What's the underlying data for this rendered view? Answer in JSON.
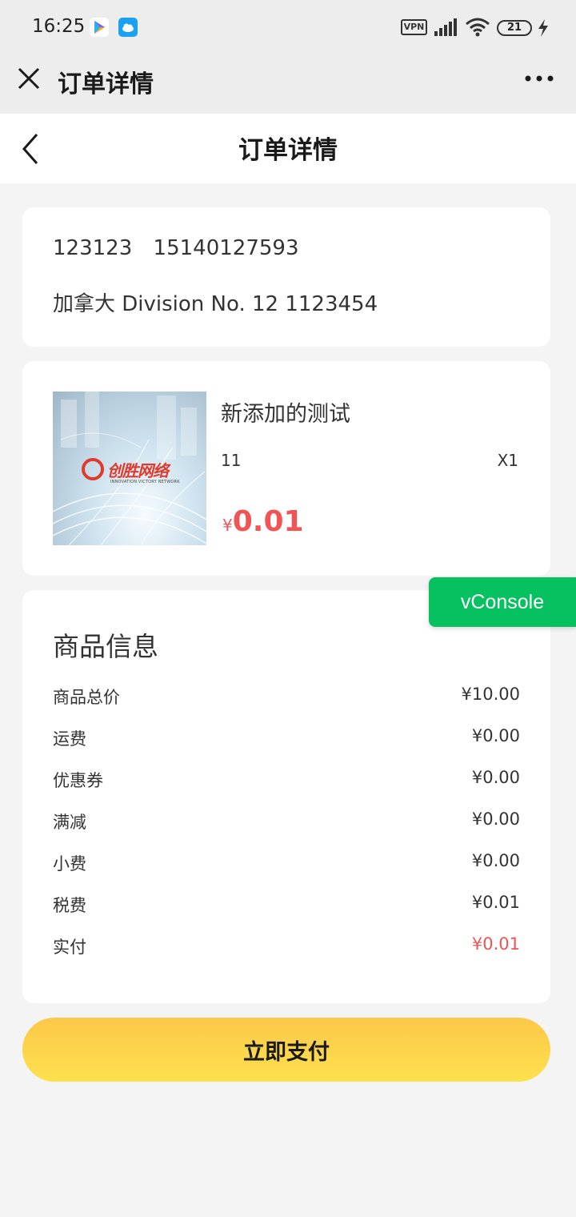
{
  "status_bar": {
    "time": "16:25",
    "vpn": "VPN",
    "battery": "21",
    "icons": [
      "play-store-icon",
      "cloud-app-icon",
      "signal-icon",
      "wifi-icon",
      "charging-icon"
    ]
  },
  "wechat_bar": {
    "title": "订单详情",
    "close_icon": "close-icon",
    "more_icon": "more-dots-icon"
  },
  "header": {
    "title": "订单详情",
    "back_icon": "chevron-left-icon"
  },
  "address": {
    "name": "123123",
    "phone": "15140127593",
    "location": "加拿大 Division No. 12 1123454"
  },
  "product": {
    "name": "新添加的测试",
    "spec": "11",
    "quantity": "X1",
    "currency": "¥",
    "price": "0.01",
    "image_logo_text": "创胜网络",
    "image_logo_subtext": "INNOVATION VICTORY NETWORK"
  },
  "info": {
    "heading": "商品信息",
    "rows": [
      {
        "label": "商品总价",
        "value": "¥10.00"
      },
      {
        "label": "运费",
        "value": "¥0.00"
      },
      {
        "label": "优惠券",
        "value": "¥0.00"
      },
      {
        "label": "满减",
        "value": "¥0.00"
      },
      {
        "label": "小费",
        "value": "¥0.00"
      },
      {
        "label": "税费",
        "value": "¥0.01"
      },
      {
        "label": "实付",
        "value": "¥0.01"
      }
    ]
  },
  "pay_button": "立即支付",
  "vconsole": "vConsole",
  "colors": {
    "price_red": "#f05454",
    "pay_button": "#fdd44a",
    "vconsole_green": "#07c160"
  }
}
